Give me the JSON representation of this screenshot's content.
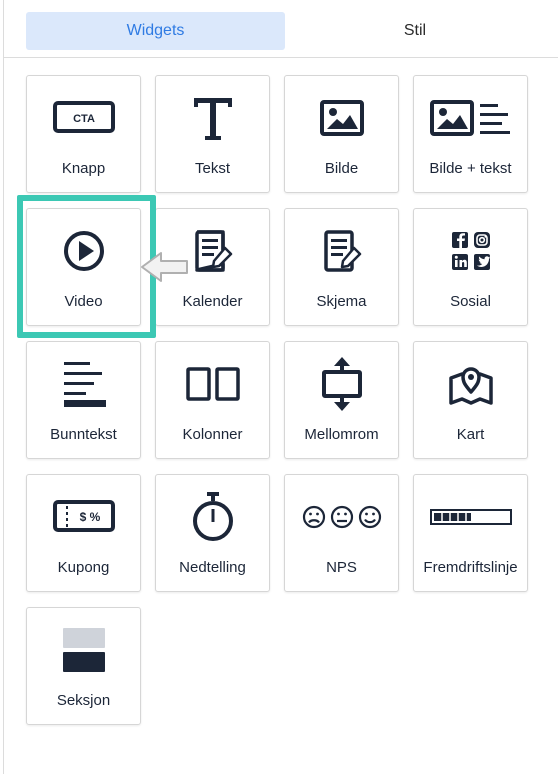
{
  "tabs": {
    "widgets": "Widgets",
    "stil": "Stil"
  },
  "colors": {
    "accent": "#2f7be3",
    "tab_active_bg": "#dbe8fb",
    "highlight": "#3cc8b4",
    "icon": "#1c2638"
  },
  "widgets": [
    {
      "label": "Knapp",
      "icon": "cta-button-icon",
      "icon_text": "CTA"
    },
    {
      "label": "Tekst",
      "icon": "text-t-icon"
    },
    {
      "label": "Bilde",
      "icon": "image-icon"
    },
    {
      "label": "Bilde + tekst",
      "icon": "image-text-icon"
    },
    {
      "label": "Video",
      "icon": "play-circle-icon"
    },
    {
      "label": "Kalender",
      "icon": "calendar-edit-icon"
    },
    {
      "label": "Skjema",
      "icon": "form-edit-icon"
    },
    {
      "label": "Sosial",
      "icon": "social-icons-icon"
    },
    {
      "label": "Bunntekst",
      "icon": "footer-lines-icon"
    },
    {
      "label": "Kolonner",
      "icon": "columns-icon"
    },
    {
      "label": "Mellomrom",
      "icon": "spacer-icon"
    },
    {
      "label": "Kart",
      "icon": "map-icon"
    },
    {
      "label": "Kupong",
      "icon": "coupon-icon",
      "icon_text": "$ %"
    },
    {
      "label": "Nedtelling",
      "icon": "stopwatch-icon"
    },
    {
      "label": "NPS",
      "icon": "nps-faces-icon"
    },
    {
      "label": "Fremdriftslinje",
      "icon": "progress-bar-icon",
      "progress": 0.5
    },
    {
      "label": "Seksjon",
      "icon": "section-icon"
    }
  ]
}
